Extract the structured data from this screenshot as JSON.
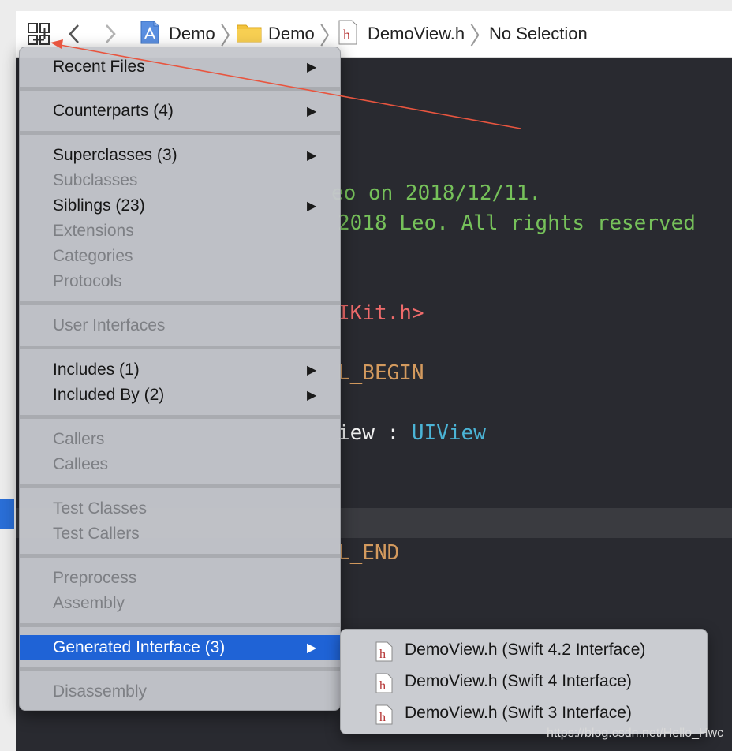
{
  "jumpbar": {
    "crumbs": [
      {
        "label": "Demo",
        "icon": "project-icon"
      },
      {
        "label": "Demo",
        "icon": "folder-icon"
      },
      {
        "label": "DemoView.h",
        "icon": "header-file-icon"
      },
      {
        "label": "No Selection"
      }
    ],
    "file_icon_letter": "h"
  },
  "editor": {
    "lines": [
      {
        "text": "eo on 2018/12/11.",
        "color": "#76c15a"
      },
      {
        "text": "2018 Leo. All rights reserved",
        "color": "#76c15a"
      },
      {
        "text": "IKit.h>",
        "color": "#ef6b6b"
      },
      {
        "text": "L_BEGIN",
        "color": "#d39a5e"
      },
      {
        "text_a": "iew : ",
        "text_b": "UIView"
      },
      {
        "text": "L_END",
        "color": "#d39a5e"
      }
    ]
  },
  "menu": {
    "items": [
      {
        "label": "Recent Files",
        "enabled": true,
        "submenu": true
      },
      {
        "label": "Counterparts (4)",
        "enabled": true,
        "submenu": true
      },
      {
        "label": "Superclasses (3)",
        "enabled": true,
        "submenu": true
      },
      {
        "label": "Subclasses",
        "enabled": false
      },
      {
        "label": "Siblings (23)",
        "enabled": true,
        "submenu": true
      },
      {
        "label": "Extensions",
        "enabled": false
      },
      {
        "label": "Categories",
        "enabled": false
      },
      {
        "label": "Protocols",
        "enabled": false
      },
      {
        "label": "User Interfaces",
        "enabled": false
      },
      {
        "label": "Includes (1)",
        "enabled": true,
        "submenu": true
      },
      {
        "label": "Included By (2)",
        "enabled": true,
        "submenu": true
      },
      {
        "label": "Callers",
        "enabled": false
      },
      {
        "label": "Callees",
        "enabled": false
      },
      {
        "label": "Test Classes",
        "enabled": false
      },
      {
        "label": "Test Callers",
        "enabled": false
      },
      {
        "label": "Preprocess",
        "enabled": false
      },
      {
        "label": "Assembly",
        "enabled": false
      },
      {
        "label": "Generated Interface (3)",
        "enabled": true,
        "submenu": true,
        "highlighted": true
      },
      {
        "label": "Disassembly",
        "enabled": false
      }
    ],
    "submenu_arrow": "▶"
  },
  "submenu": {
    "items": [
      {
        "label": "DemoView.h (Swift 4.2 Interface)"
      },
      {
        "label": "DemoView.h (Swift 4 Interface)"
      },
      {
        "label": "DemoView.h (Swift 3 Interface)"
      }
    ]
  },
  "watermark": "https://blog.csdn.net/Hello_Hwc",
  "colors": {
    "editor_bg": "#292a30",
    "menu_highlight": "#1f63d6",
    "annotation_arrow": "#e8553f"
  }
}
